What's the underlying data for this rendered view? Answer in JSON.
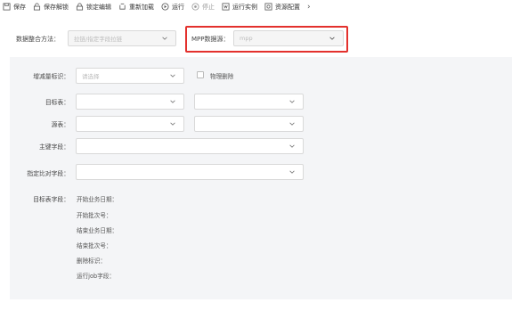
{
  "toolbar": {
    "items": [
      {
        "label": "保存",
        "icon": "save-icon"
      },
      {
        "label": "保存解锁",
        "icon": "unlock-icon"
      },
      {
        "label": "锁定编辑",
        "icon": "lock-icon"
      },
      {
        "label": "重新加载",
        "icon": "reload-icon"
      },
      {
        "label": "运行",
        "icon": "run-icon"
      },
      {
        "label": "停止",
        "icon": "stop-icon"
      },
      {
        "label": "运行实例",
        "icon": "instance-icon"
      },
      {
        "label": "资源配置",
        "icon": "resource-config-icon"
      }
    ],
    "more": "›"
  },
  "integration_method": {
    "label": "数据整合方法：",
    "placeholder": "拉链/指定字段拉链"
  },
  "mpp_source": {
    "label": "MPP数据源：",
    "value": "mpp"
  },
  "panel": {
    "incremental": {
      "label": "增减量标识：",
      "placeholder": "请选择"
    },
    "physical_delete": {
      "label": "物理删除",
      "checked": false
    },
    "target_table": {
      "label": "目标表："
    },
    "source_table": {
      "label": "源表："
    },
    "primary_key": {
      "label": "主键字段："
    },
    "compare_field": {
      "label": "指定比对字段："
    },
    "target_fields": {
      "label": "目标表字段：",
      "items": [
        "开始业务日期：",
        "开始批次号：",
        "结束业务日期：",
        "结束批次号：",
        "删除标识：",
        "运行job字段："
      ]
    }
  },
  "colors": {
    "highlight": "#e3312d",
    "panel_bg": "#f4f5f7",
    "border": "#d9d9d9"
  }
}
